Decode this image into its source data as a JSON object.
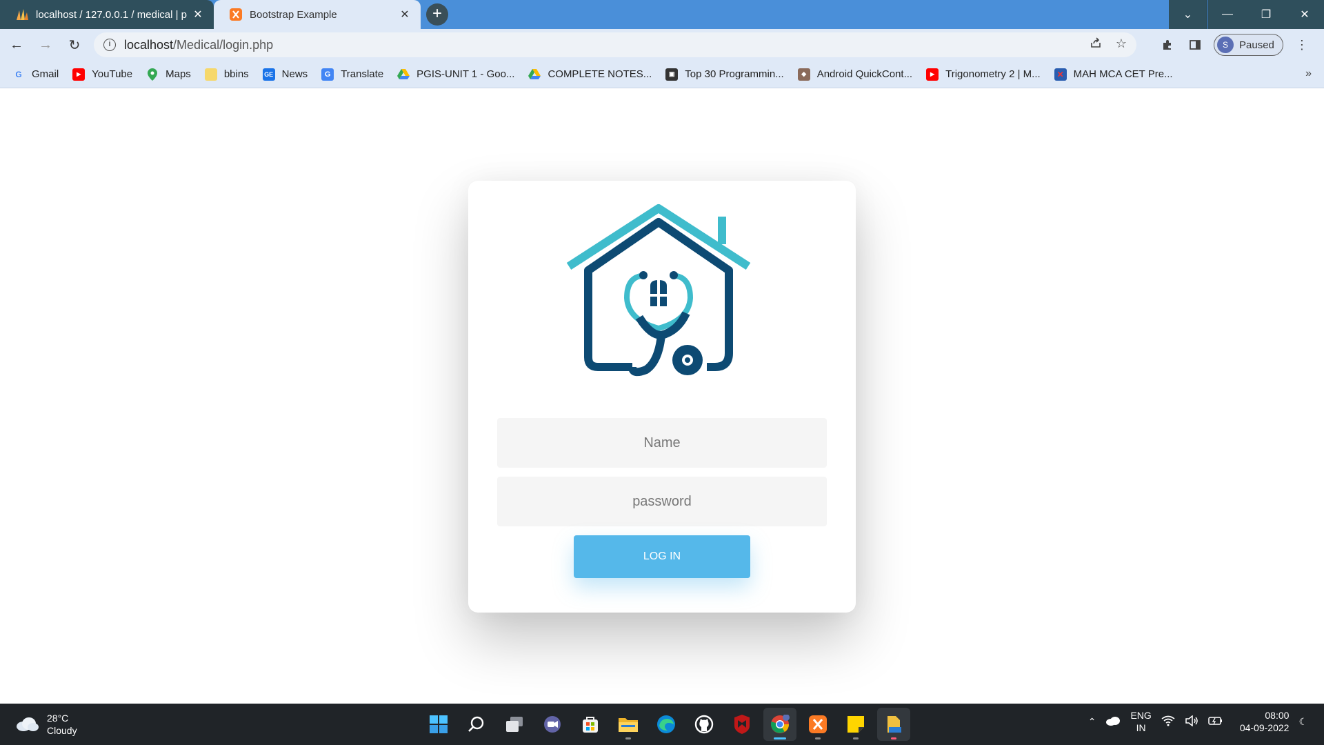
{
  "browser": {
    "tabs": [
      {
        "title": "localhost / 127.0.0.1 / medical | p",
        "icon": "phpmyadmin-icon",
        "active": false
      },
      {
        "title": "Bootstrap Example",
        "icon": "xampp-icon",
        "active": true
      }
    ],
    "new_tab": "+",
    "window_controls": {
      "dropdown": "⌄",
      "minimize": "—",
      "restore": "❐",
      "close": "✕"
    },
    "url": {
      "host": "localhost",
      "path": "/Medical/login.php"
    },
    "profile": {
      "initial": "S",
      "status": "Paused"
    }
  },
  "bookmarks": [
    {
      "label": "Gmail",
      "icon": "google-icon"
    },
    {
      "label": "YouTube",
      "icon": "youtube-icon"
    },
    {
      "label": "Maps",
      "icon": "maps-icon"
    },
    {
      "label": "bbins",
      "icon": "folder-icon"
    },
    {
      "label": "News",
      "icon": "news-icon"
    },
    {
      "label": "Translate",
      "icon": "translate-icon"
    },
    {
      "label": "PGIS-UNIT 1 - Goo...",
      "icon": "drive-icon"
    },
    {
      "label": "COMPLETE NOTES...",
      "icon": "drive-icon"
    },
    {
      "label": "Top 30 Programmin...",
      "icon": "site-icon"
    },
    {
      "label": "Android QuickCont...",
      "icon": "site-icon"
    },
    {
      "label": "Trigonometry 2 | M...",
      "icon": "youtube-icon"
    },
    {
      "label": "MAH MCA CET Pre...",
      "icon": "site-icon"
    }
  ],
  "bookmarks_more": "»",
  "login": {
    "logo": "medical-home-logo",
    "name_placeholder": "Name",
    "password_placeholder": "password",
    "button_label": "LOG IN"
  },
  "taskbar": {
    "weather": {
      "temp": "28°C",
      "condition": "Cloudy"
    },
    "language": {
      "line1": "ENG",
      "line2": "IN"
    },
    "clock": {
      "time": "08:00",
      "date": "04-09-2022"
    }
  },
  "colors": {
    "tabbar": "#4a8fd9",
    "accent_button": "#55b8ea",
    "logo_dark": "#0d4a73",
    "logo_teal": "#3fbccc"
  }
}
